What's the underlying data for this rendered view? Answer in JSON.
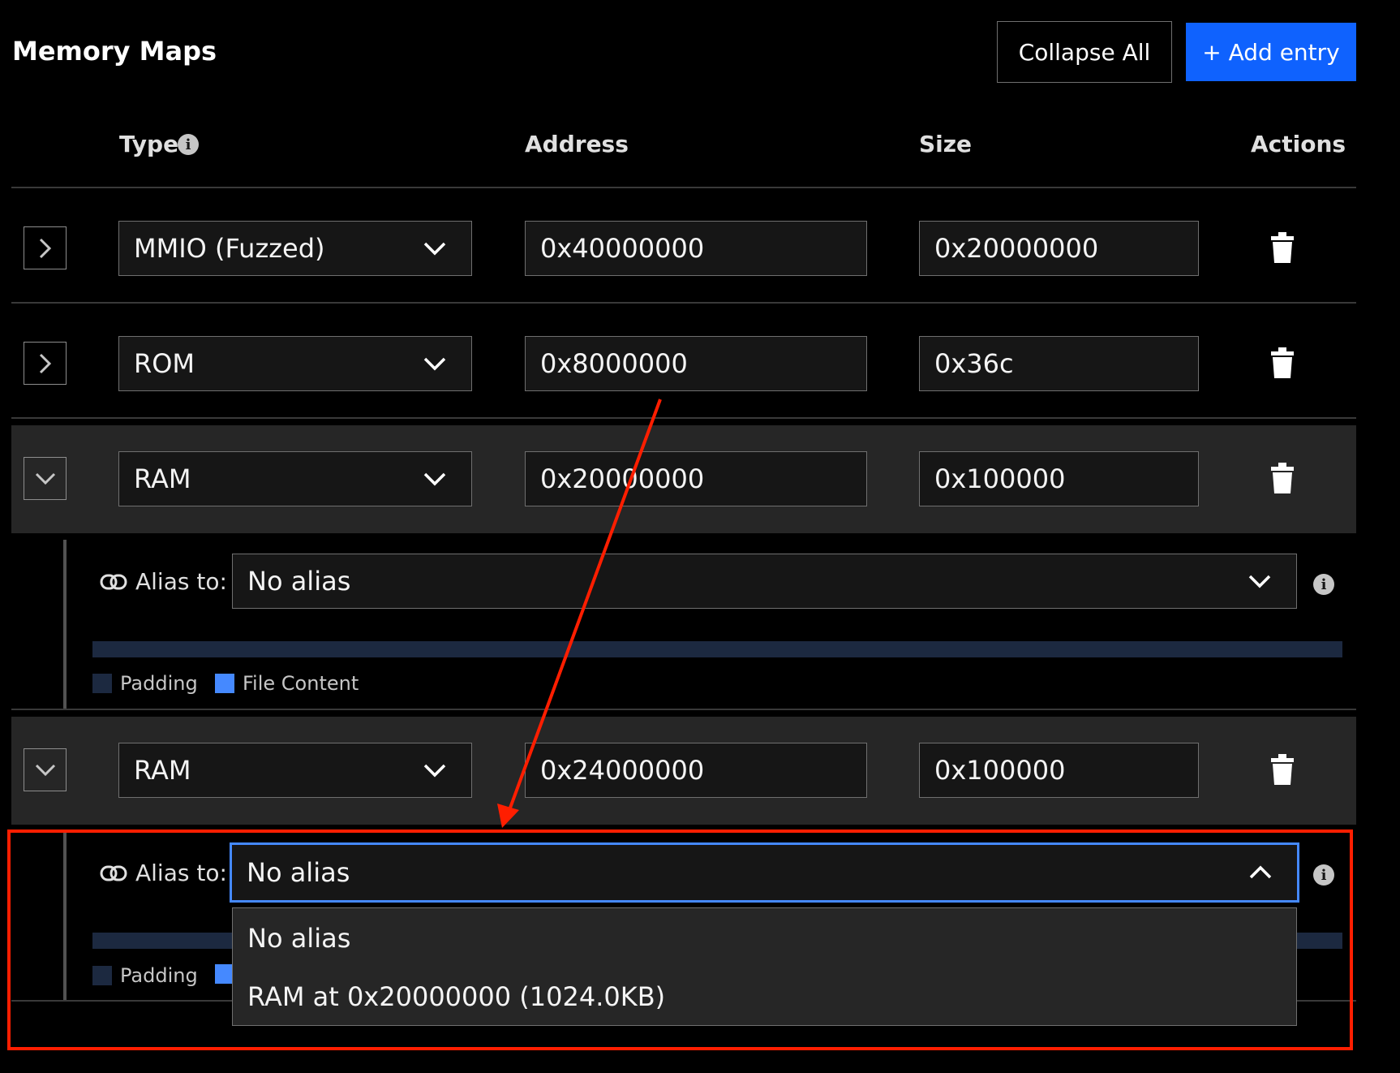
{
  "header": {
    "title": "Memory Maps",
    "collapse_label": "Collapse All",
    "add_label": "+ Add entry"
  },
  "columns": {
    "type": "Type",
    "address": "Address",
    "size": "Size",
    "actions": "Actions"
  },
  "rows": [
    {
      "type": "MMIO (Fuzzed)",
      "address": "0x40000000",
      "size": "0x20000000",
      "expanded": false
    },
    {
      "type": "ROM",
      "address": "0x8000000",
      "size": "0x36c",
      "expanded": false
    },
    {
      "type": "RAM",
      "address": "0x20000000",
      "size": "0x100000",
      "expanded": true,
      "alias": "No alias"
    },
    {
      "type": "RAM",
      "address": "0x24000000",
      "size": "0x100000",
      "expanded": true,
      "alias": "No alias",
      "alias_open": true
    }
  ],
  "alias_label": "Alias to:",
  "legend": {
    "padding": "Padding",
    "file_content": "File Content"
  },
  "alias_options": [
    "No alias",
    "RAM at 0x20000000 (1024.0KB)"
  ],
  "icons": {
    "expand": "chevron-right-icon",
    "collapse": "chevron-down-icon",
    "delete": "trash-icon",
    "info": "info-icon",
    "link": "link-icon",
    "dropdown": "chevron-down-icon",
    "dropdown_open": "chevron-up-icon"
  },
  "colors": {
    "primary": "#0f62fe",
    "focus": "#4589ff",
    "annotation": "#ff1e00",
    "padding_swatch": "#1c2940",
    "file_content_swatch": "#4589ff"
  }
}
